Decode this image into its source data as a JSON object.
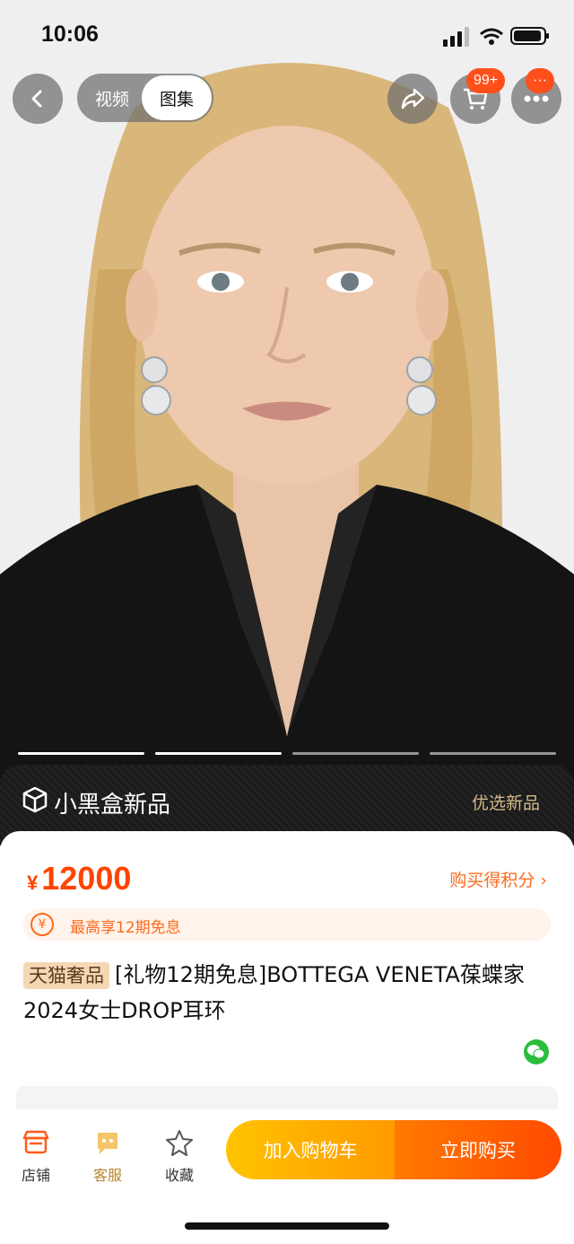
{
  "status_bar": {
    "time": "10:06"
  },
  "top_nav": {
    "tab_video": "视频",
    "tab_gallery": "图集",
    "cart_badge": "99+",
    "more_badge": "···"
  },
  "gallery": {
    "pages": 4,
    "active_page": 2
  },
  "banner": {
    "title": "小黑盒新品",
    "right_text": "优选新品"
  },
  "product": {
    "currency": "¥",
    "price": "12000",
    "points_link": "购买得积分 ›",
    "installment": "最高享12期免息",
    "tag": "天猫奢品",
    "title": "[礼物12期免息]BOTTEGA VENETA葆蝶家2024女士DROP耳环"
  },
  "bottom_bar": {
    "store_label": "店铺",
    "service_label": "客服",
    "favorite_label": "收藏",
    "add_to_cart": "加入购物车",
    "buy_now": "立即购买"
  },
  "colors": {
    "accent": "#ff4400",
    "cart_gradient_start": "#ffc300",
    "buy_gradient_end": "#ff4a00",
    "tag_bg": "#f5d7b4",
    "banner_gold": "#d4b98a"
  }
}
